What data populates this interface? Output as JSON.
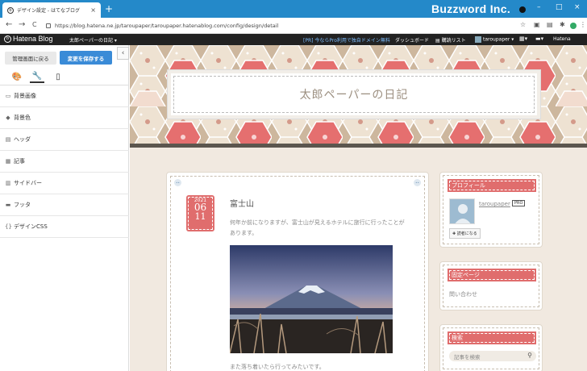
{
  "browser": {
    "tab_title": "デザイン設定 - はてなブログ",
    "tab_close": "×",
    "new_tab": "+",
    "brand_overlay": "Buzzword Inc.",
    "url": "https://blog.hatena.ne.jp/taroupaper/taroupaper.hatenablog.com/config/design/detail",
    "nav": {
      "back": "←",
      "forward": "→",
      "reload": "C"
    },
    "window_controls": {
      "minimize": "–",
      "maximize": "□",
      "close": "×"
    }
  },
  "hatena_bar": {
    "logo": "Hatena Blog",
    "blog_select": "太郎ペーパーの日記 ▾",
    "promo": "[PR] 今ならPro利用で独自ドメイン無料",
    "dashboard": "ダッシュボード",
    "reading_list": "購読リスト",
    "user": "taroupaper ▾",
    "right_logo": "Hatena"
  },
  "sidebar": {
    "back_button": "管理画面に戻る",
    "save_button": "変更を保存する",
    "collapse": "‹",
    "tabs": [
      "🎨",
      "🔧",
      "▯"
    ],
    "items": [
      {
        "icon": "▭",
        "label": "背景画像"
      },
      {
        "icon": "◆",
        "label": "背景色"
      },
      {
        "icon": "▤",
        "label": "ヘッダ"
      },
      {
        "icon": "▦",
        "label": "記事"
      },
      {
        "icon": "▥",
        "label": "サイドバー"
      },
      {
        "icon": "▬",
        "label": "フッタ"
      },
      {
        "icon": "{}",
        "label": "デザインCSS"
      }
    ]
  },
  "blog": {
    "title": "太郎ペーパーの日記",
    "post": {
      "year": "2021",
      "month": "06",
      "day": "11",
      "title": "富士山",
      "body": "何年か前になりますが、富士山が見えるホテルに旅行に行ったことがあります。",
      "body2": "また落ち着いたら行ってみたいです。"
    },
    "profile": {
      "heading": "プロフィール",
      "name": "taroupaper",
      "badge": "PRO",
      "readers_button": "✚ 読者になる"
    },
    "fixed_page": {
      "heading": "固定ページ",
      "link": "問い合わせ"
    },
    "search": {
      "heading": "検索",
      "placeholder": "記事を検索"
    }
  }
}
